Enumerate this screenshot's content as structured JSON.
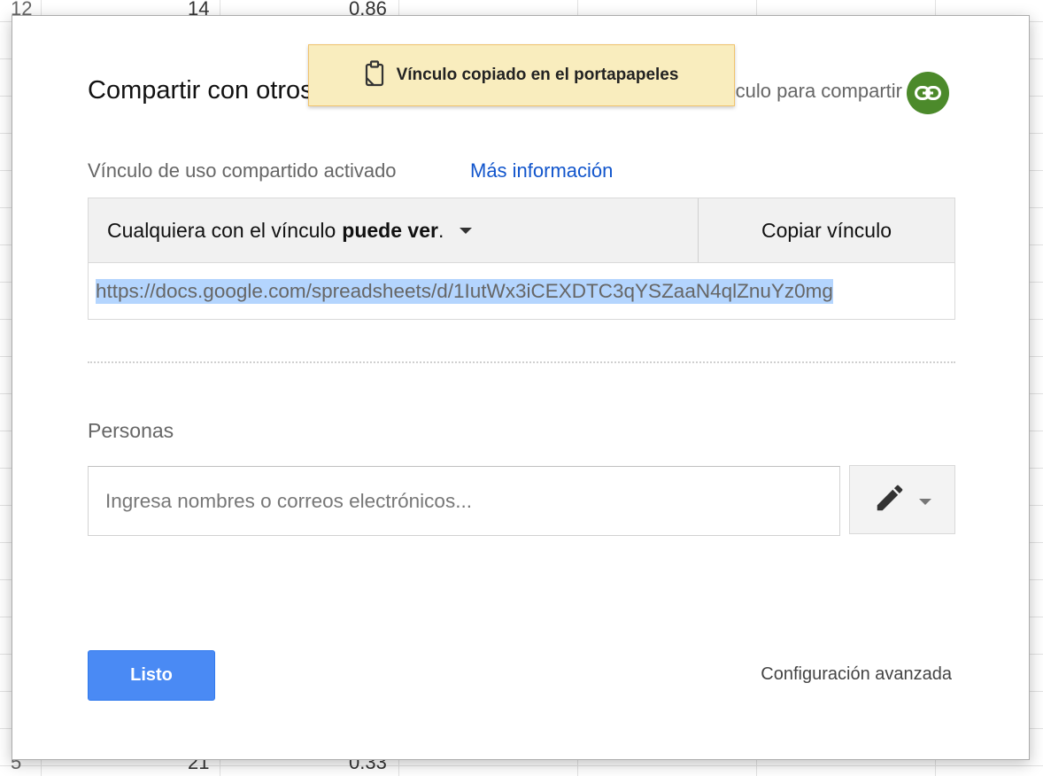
{
  "sheet": {
    "top_row": [
      "12",
      "14",
      "0.86"
    ],
    "bottom_row": [
      "5",
      "21",
      "0.33"
    ]
  },
  "toast": {
    "text": "Vínculo copiado en el portapapeles",
    "icon": "clipboard-icon",
    "background": "#f9edbe"
  },
  "dialog": {
    "title": "Compartir con otros",
    "link_share_label": "Obtener vínculo para compartir",
    "link_share_icon": "link-icon",
    "link_icon_color": "#4c8a2b",
    "share_status": "Vínculo de uso compartido activado",
    "more_info": "Más información",
    "access": {
      "prefix": "Cualquiera con el vínculo",
      "level": "puede ver",
      "suffix": "."
    },
    "copy_link": "Copiar vínculo",
    "url": "https://docs.google.com/spreadsheets/d/1IutWx3iCEXDTC3qYSZaaN4qlZnuYz0mg",
    "people_label": "Personas",
    "people_placeholder": "Ingresa nombres o correos electrónicos...",
    "permission_icon": "pencil-icon",
    "done_button": "Listo",
    "done_color": "#4a8af4",
    "advanced": "Configuración avanzada"
  }
}
